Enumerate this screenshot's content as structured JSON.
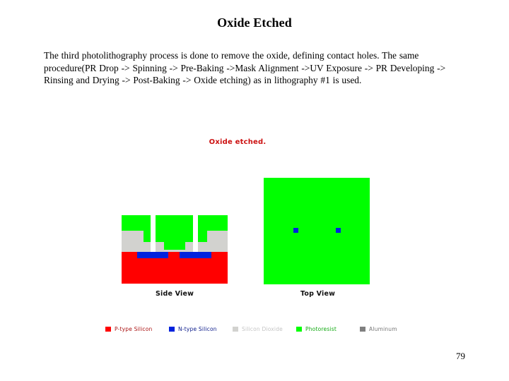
{
  "slide": {
    "title": "Oxide Etched",
    "body_text": "The  third  photolithography  process is done  to remove the oxide,  defining  contact holes. The same procedure(PR Drop -> Spinning -> Pre-Baking ->Mask Alignment ->UV Exposure -> PR Developing -> Rinsing and Drying -> Post-Baking -> Oxide etching) as in lithography #1  is used.",
    "page_number": "79"
  },
  "diagram": {
    "title": "Oxide etched.",
    "title_color": "#cc1111",
    "side_view_label": "Side View",
    "top_view_label": "Top View",
    "top_view_contact_count": 2,
    "legend": [
      {
        "label": "P-type Silicon",
        "color": "#ff0000",
        "text_color": "#aa1111"
      },
      {
        "label": "N-type Silicon",
        "color": "#0022dd",
        "text_color": "#0a1a8a"
      },
      {
        "label": "Silicon Dioxide",
        "color": "#d2d2cf",
        "text_color": "#c4c4c4"
      },
      {
        "label": "Photoresist",
        "color": "#00ff00",
        "text_color": "#11aa11"
      },
      {
        "label": "Aluminum",
        "color": "#808080",
        "text_color": "#777777"
      }
    ]
  }
}
